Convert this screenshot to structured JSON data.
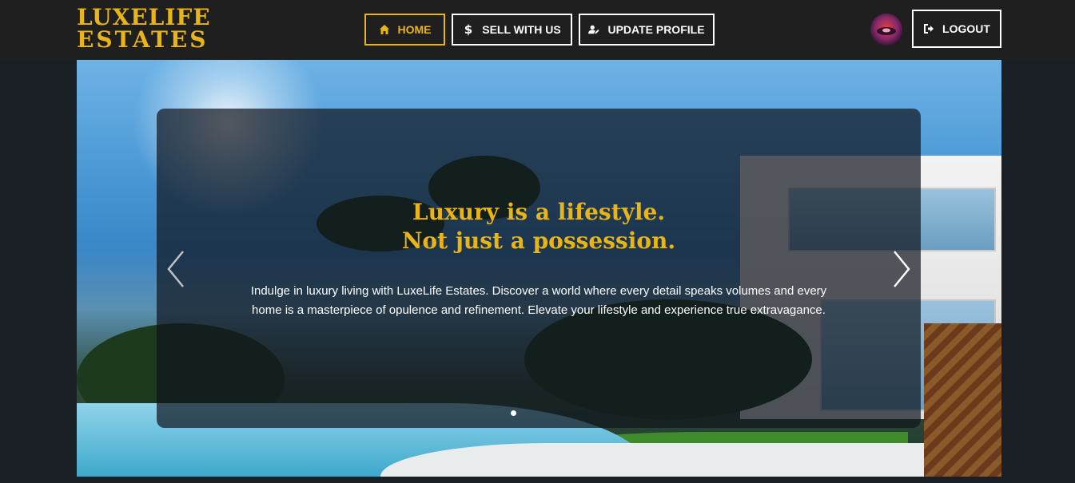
{
  "brand": {
    "line1": "LUXELIFE",
    "line2": "ESTATES"
  },
  "nav": {
    "home": "HOME",
    "sell": "SELL WITH US",
    "profile": "UPDATE PROFILE",
    "logout": "LOGOUT"
  },
  "hero": {
    "headline_line1": "Luxury is a lifestyle.",
    "headline_line2": "Not just a possession.",
    "description": "Indulge in luxury living with LuxeLife Estates. Discover a world where every detail speaks volumes and every home is a masterpiece of opulence and refinement. Elevate your lifestyle and experience true extravagance."
  },
  "carousel": {
    "slide_count": 1,
    "active_slide": 1
  },
  "icons": {
    "home": "home-icon",
    "sell": "dollar-icon",
    "profile": "user-edit-icon",
    "logout": "sign-out-icon",
    "prev": "chevron-left-icon",
    "next": "chevron-right-icon"
  },
  "colors": {
    "accent": "#e8b417",
    "navbar": "#1f1f1f",
    "page_bg": "#1a1f26"
  }
}
